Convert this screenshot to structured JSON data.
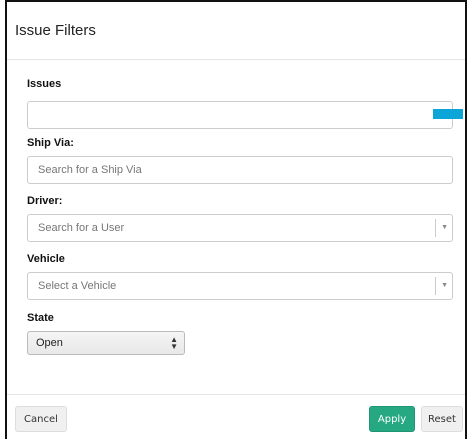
{
  "dialog": {
    "title": "Issue Filters"
  },
  "fields": {
    "issues": {
      "label": "Issues",
      "value": ""
    },
    "ship_via": {
      "label": "Ship Via:",
      "placeholder": "Search for a Ship Via"
    },
    "driver": {
      "label": "Driver:",
      "placeholder": "Search for a User"
    },
    "vehicle": {
      "label": "Vehicle",
      "placeholder": "Select a Vehicle"
    },
    "state": {
      "label": "State",
      "selected": "Open"
    }
  },
  "footer": {
    "cancel_label": "Cancel",
    "apply_label": "Apply",
    "reset_label": "Reset"
  },
  "colors": {
    "apply_button": "#26a883",
    "marker": "#0ba5d8"
  }
}
